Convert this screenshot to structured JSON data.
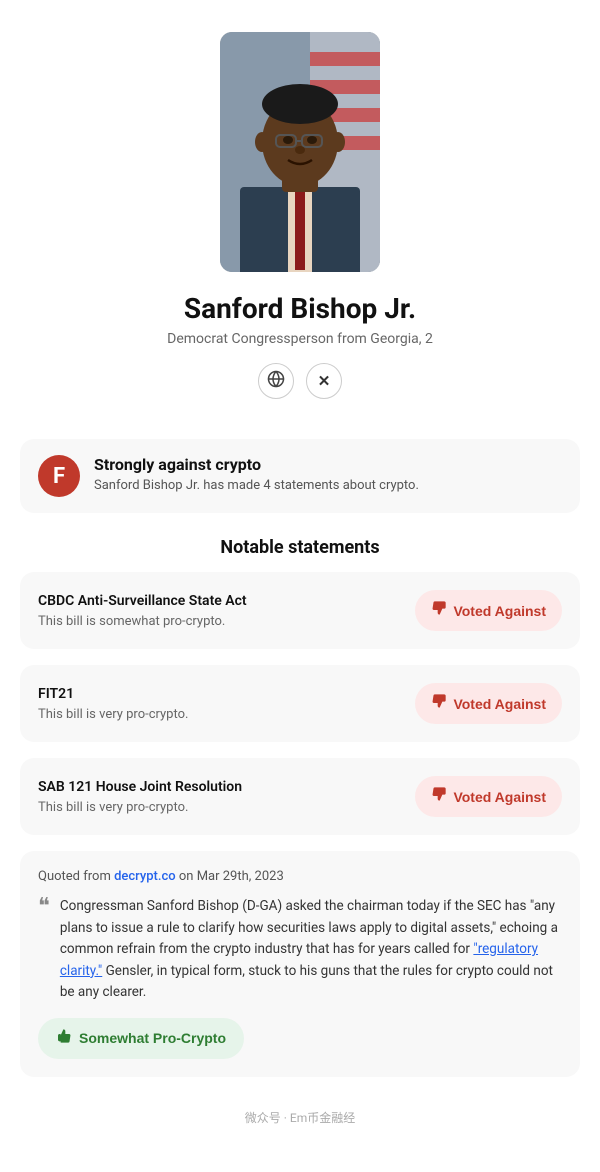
{
  "profile": {
    "name": "Sanford Bishop Jr.",
    "subtitle": "Democrat Congressperson from Georgia, 2",
    "photo_alt": "Sanford Bishop Jr. official photo"
  },
  "grade": {
    "letter": "F",
    "title": "Strongly against crypto",
    "description": "Sanford Bishop Jr. has made 4 statements about crypto."
  },
  "notable_statements": {
    "section_title": "Notable statements",
    "votes": [
      {
        "bill_title": "CBDC Anti-Surveillance State Act",
        "bill_desc": "This bill is somewhat pro-crypto.",
        "vote_label": "Voted Against"
      },
      {
        "bill_title": "FIT21",
        "bill_desc": "This bill is very pro-crypto.",
        "vote_label": "Voted Against"
      },
      {
        "bill_title": "SAB 121 House Joint Resolution",
        "bill_desc": "This bill is very pro-crypto.",
        "vote_label": "Voted Against"
      }
    ]
  },
  "quote": {
    "source_prefix": "Quoted from",
    "source_link": "decrypt.co",
    "source_date": "on Mar 29th, 2023",
    "text": "Congressman Sanford Bishop (D-GA) asked the chairman today if the SEC has \"any plans to issue a rule to clarify how securities laws apply to digital assets,\" echoing a common refrain from the crypto industry that has for years called for \"regulatory clarity.\" Gensler, in typical form, stuck to his guns that the rules for crypto could not be any clearer.",
    "sentiment_label": "Somewhat Pro-Crypto",
    "sentiment_link_text": "regulatory clarity"
  },
  "icons": {
    "globe": "🌐",
    "twitter": "✕",
    "thumbs_down": "👎",
    "thumbs_up": "👍",
    "quote_mark": "❝"
  },
  "watermark": "微众号 · Em币金融经"
}
